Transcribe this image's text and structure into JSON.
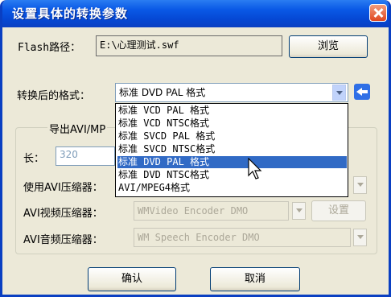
{
  "window": {
    "title": "设置具体的转换参数"
  },
  "flash": {
    "label": "Flash路径：",
    "path": "E:\\心理测试.swf",
    "browse_label": "浏览"
  },
  "format": {
    "label": "转换后的格式：",
    "selected": "标准 DVD  PAL 格式",
    "options": [
      "标准 VCD  PAL 格式",
      "标准 VCD  NTSC格式",
      "标准 SVCD PAL 格式",
      "标准 SVCD NTSC格式",
      "标准 DVD  PAL 格式",
      "标准 DVD  NTSC格式",
      "AVI/MPEG4格式"
    ],
    "highlighted_index": 4
  },
  "avi_group": {
    "title_visible": "导出AVI/MP",
    "length_label": "长：",
    "length_value": "320",
    "use_compressor_label": "使用AVI压缩器：",
    "video_compressor_label": "AVI视频压缩器：",
    "video_compressor_value": "WMVideo Encoder DMO",
    "settings_label": "设置",
    "audio_compressor_label": "AVI音频压缩器：",
    "audio_compressor_value": "WM Speech Encoder DMO"
  },
  "footer": {
    "ok_label": "确认",
    "cancel_label": "取消"
  },
  "colors": {
    "titlebar": "#0a59e6",
    "selection": "#316ac5",
    "dialog_bg": "#ece9d8"
  }
}
